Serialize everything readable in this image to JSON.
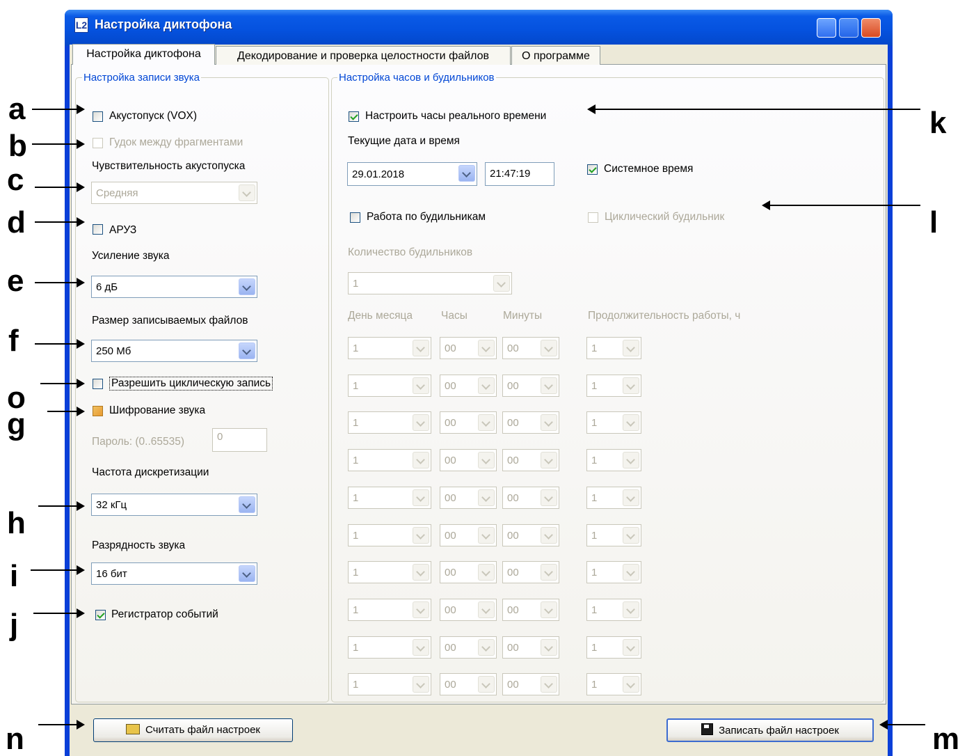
{
  "window": {
    "title": "Настройка диктофона",
    "icon_char": "L2"
  },
  "tabs": [
    "Настройка диктофона",
    "Декодирование и проверка целостности файлов",
    "О программе"
  ],
  "left_group": {
    "title": "Настройка записи звука",
    "vox_label": "Акустопуск (VOX)",
    "beep_label": "Гудок между фрагментами",
    "sensitivity_label": "Чувствительность акустопуска",
    "sensitivity_value": "Средняя",
    "agc_label": "АРУЗ",
    "gain_label": "Усиление звука",
    "gain_value": "6 дБ",
    "filesize_label": "Размер записываемых файлов",
    "filesize_value": "250 Мб",
    "cyclic_label": "Разрешить циклическую запись",
    "encrypt_label": "Шифрование звука",
    "password_label": "Пароль: (0..65535)",
    "password_value": "0",
    "samplerate_label": "Частота дискретизации",
    "samplerate_value": "32 кГц",
    "bitdepth_label": "Разрядность звука",
    "bitdepth_value": "16 бит",
    "eventlog_label": "Регистратор событий"
  },
  "right_group": {
    "title": "Настройка часов и будильников",
    "rtc_label": "Настроить часы реального времени",
    "datetime_label": "Текущие дата и время",
    "date_value": "29.01.2018",
    "time_value": "21:47:19",
    "systime_label": "Системное время",
    "alarms_label": "Работа по будильникам",
    "cyclic_alarm_label": "Циклический будильник",
    "alarm_count_label": "Количество будильников",
    "alarm_count_value": "1",
    "col_day": "День месяца",
    "col_hours": "Часы",
    "col_minutes": "Минуты",
    "col_duration": "Продолжительность работы, ч",
    "alarm_rows": [
      {
        "day": "1",
        "hours": "00",
        "minutes": "00",
        "duration": "1"
      },
      {
        "day": "1",
        "hours": "00",
        "minutes": "00",
        "duration": "1"
      },
      {
        "day": "1",
        "hours": "00",
        "minutes": "00",
        "duration": "1"
      },
      {
        "day": "1",
        "hours": "00",
        "minutes": "00",
        "duration": "1"
      },
      {
        "day": "1",
        "hours": "00",
        "minutes": "00",
        "duration": "1"
      },
      {
        "day": "1",
        "hours": "00",
        "minutes": "00",
        "duration": "1"
      },
      {
        "day": "1",
        "hours": "00",
        "minutes": "00",
        "duration": "1"
      },
      {
        "day": "1",
        "hours": "00",
        "minutes": "00",
        "duration": "1"
      },
      {
        "day": "1",
        "hours": "00",
        "minutes": "00",
        "duration": "1"
      },
      {
        "day": "1",
        "hours": "00",
        "minutes": "00",
        "duration": "1"
      }
    ]
  },
  "buttons": {
    "read": "Считать файл настроек",
    "write": "Записать файл настроек"
  },
  "annotations": {
    "a": "a",
    "b": "b",
    "c": "c",
    "d": "d",
    "e": "e",
    "f": "f",
    "o": "o",
    "g": "g",
    "h": "h",
    "i": "i",
    "j": "j",
    "k": "k",
    "l": "l",
    "m": "m",
    "n": "n"
  }
}
